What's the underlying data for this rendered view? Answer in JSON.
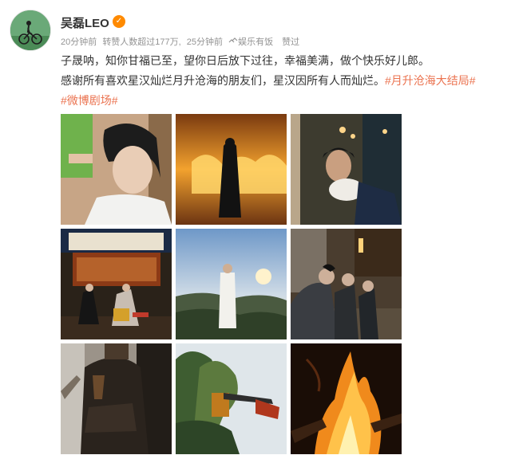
{
  "user": {
    "name": "吴磊LEO",
    "avatar_icon": "cyclist-avatar-icon",
    "badge_icon": "verified-badge-icon"
  },
  "meta": {
    "time": "20分钟前",
    "reposts": "转赞人数超过177万,",
    "edit_time": "25分钟前",
    "source_icon": "link-icon",
    "source": "娱乐有饭",
    "liked": "赞过"
  },
  "post": {
    "line1": "子晟呐，知你甘福已至，望你日后放下过往，幸福美满，做个快乐好儿郎。",
    "line2_text": "感谢所有喜欢星汉灿烂月升沧海的朋友们，星汉因所有人而灿烂。",
    "hashtag1": "#月升沧海大结局#",
    "hashtag2": "#微博剧场#"
  },
  "colors": {
    "hashtag": "#eb7350",
    "meta": "#939393",
    "name": "#333333",
    "verified": "#ff8a00"
  },
  "photos": [
    {
      "name": "photo-1",
      "desc": "portrait-makeup"
    },
    {
      "name": "photo-2",
      "desc": "figure-before-fire"
    },
    {
      "name": "photo-3",
      "desc": "man-at-window"
    },
    {
      "name": "photo-4",
      "desc": "two-men-seated-hall"
    },
    {
      "name": "photo-5",
      "desc": "man-on-hillside-sky"
    },
    {
      "name": "photo-6",
      "desc": "group-of-men-outdoors"
    },
    {
      "name": "photo-7",
      "desc": "man-in-costume-on-set"
    },
    {
      "name": "photo-8",
      "desc": "trees-with-crane"
    },
    {
      "name": "photo-9",
      "desc": "bonfire-flames"
    }
  ]
}
